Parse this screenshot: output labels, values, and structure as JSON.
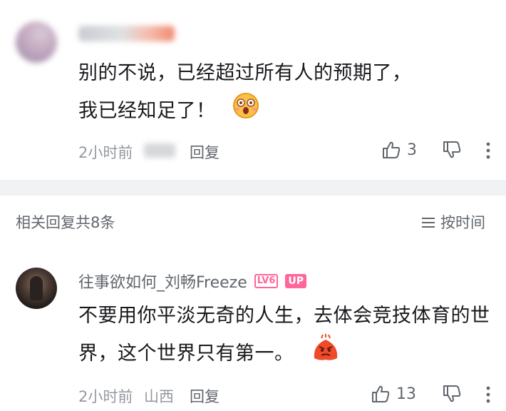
{
  "comment1": {
    "text": "别的不说，已经超过所有人的预期了，我已经知足了！",
    "time": "2小时前",
    "reply_label": "回复",
    "likes": "3"
  },
  "replies_header": {
    "title": "相关回复共8条",
    "sort_label": "按时间"
  },
  "comment2": {
    "username": "往事欲如何_刘畅Freeze",
    "level_badge": "LV6",
    "up_badge": "UP",
    "text": "不要用你平淡无奇的人生，去体会竞技体育的世界，这个世界只有第一。",
    "time": "2小时前",
    "location": "山西",
    "reply_label": "回复",
    "likes": "13"
  },
  "colors": {
    "accent_pink": "#ff6699",
    "meta_gray": "#9499a0",
    "band_gray": "#f1f2f3"
  }
}
